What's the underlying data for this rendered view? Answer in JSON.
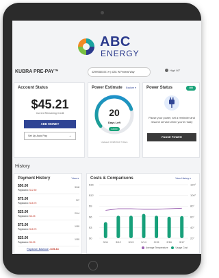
{
  "logo": {
    "line1": "ABC",
    "line2": "ENERGY",
    "colors": [
      "#f08a24",
      "#1aa3a0",
      "#2b3a8c",
      "#7ac043"
    ]
  },
  "header": {
    "brand": "KUBRA PRE-PAY™",
    "account": "42999380-001 ▾ | 4251 W Federal Way",
    "weather": "High 80°"
  },
  "account_status": {
    "title": "Account Status",
    "balance": "$45.21",
    "balance_sub": "Current Remaining Credit",
    "add_money": "ADD MONEY",
    "auto_pay": "Set Up Auto Pay",
    "auto_pay_arrow": "→"
  },
  "power_estimate": {
    "title": "Power Estimate",
    "explore": "Explore ▾",
    "days": "20",
    "days_label": "Days Left",
    "badge": "GOOD",
    "updated": "Updated: 03/28/2019 7:00am",
    "gauge_fraction": 0.78
  },
  "power_status": {
    "title": "Power Status",
    "status": "ON",
    "text": "Pause your power, set a reminder and resume service when you're ready",
    "pause_button": "PAUSE POWER"
  },
  "history": {
    "title": "History"
  },
  "payment_history": {
    "title": "Payment History",
    "view": "View ▾",
    "rows": [
      {
        "amount": "$50.00",
        "paydown_label": "Paydown:",
        "paydown": "$12.50",
        "date": "3/18"
      },
      {
        "amount": "$75.00",
        "paydown_label": "Paydown:",
        "paydown": "$18.75",
        "date": "3/7"
      },
      {
        "amount": "$25.00",
        "paydown_label": "Paydown:",
        "paydown": "$6.25",
        "date": "2/14"
      },
      {
        "amount": "$75.00",
        "paydown_label": "Paydown:",
        "paydown": "$18.75",
        "date": "1/30"
      },
      {
        "amount": "$25.00",
        "paydown_label": "Paydown:",
        "paydown": "$6.25",
        "date": "1/30"
      }
    ],
    "balance_label": "Paydown Balance",
    "balance_value": "-$78.44"
  },
  "costs": {
    "title": "Costs & Comparisons",
    "view": "View History ▾",
    "legend_temp": "Average Temperature",
    "legend_cost": "Usage Cost",
    "colors": {
      "bar": "#17a07a",
      "line": "#9a5fb0",
      "grid": "#e6e6e6"
    }
  },
  "chart_data": {
    "type": "bar",
    "categories": [
      "3/11",
      "3/12",
      "3/13",
      "3/14",
      "3/15",
      "3/16",
      "3/17"
    ],
    "series": [
      {
        "name": "Usage Cost",
        "type": "bar",
        "axis": "left",
        "values": [
          4.5,
          6.3,
          6.3,
          6.8,
          6.3,
          6.0,
          6.2
        ]
      },
      {
        "name": "Average Temperature",
        "type": "line",
        "axis": "right",
        "values": [
          72,
          75,
          75,
          74,
          74,
          75,
          76
        ]
      }
    ],
    "y_left_ticks": [
      "$15",
      "$12",
      "$9",
      "$6",
      "$3",
      "$0"
    ],
    "y_right_ticks": [
      "120°",
      "100°",
      "80°",
      "60°",
      "40°",
      "20°"
    ],
    "ylim_left": [
      0,
      15
    ],
    "ylim_right": [
      20,
      120
    ],
    "grid": true,
    "legend_position": "bottom-right"
  }
}
